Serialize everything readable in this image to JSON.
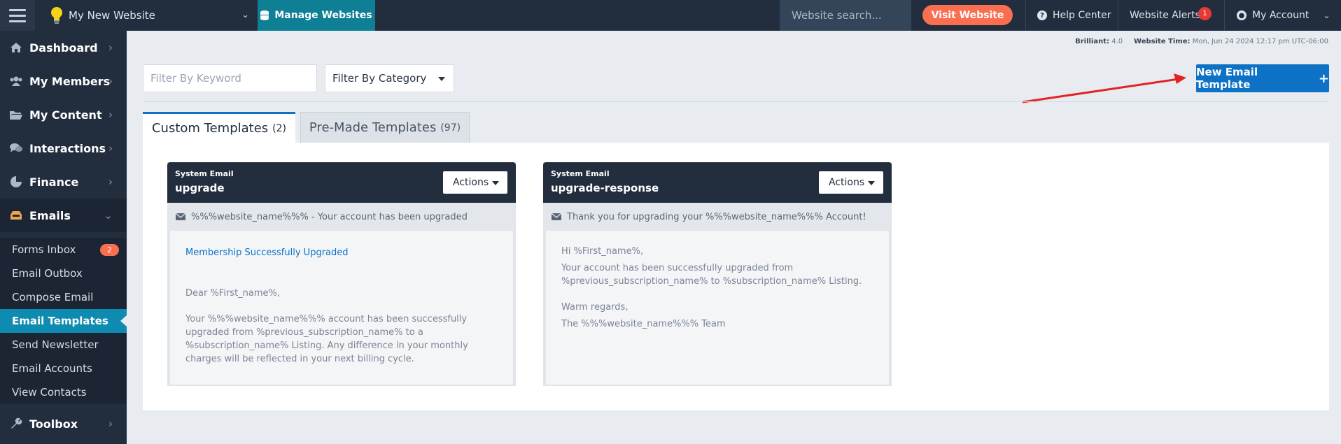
{
  "topbar": {
    "site_name": "My New Website",
    "manage_label": "Manage Websites",
    "search_placeholder": "Website search...",
    "visit_label": "Visit Website",
    "help_label": "Help Center",
    "alerts_label": "Website Alerts",
    "alerts_count": "1",
    "account_label": "My Account"
  },
  "sidebar": {
    "items": [
      {
        "label": "Dashboard",
        "icon": "home-icon"
      },
      {
        "label": "My Members",
        "icon": "users-icon"
      },
      {
        "label": "My Content",
        "icon": "folder-icon"
      },
      {
        "label": "Interactions",
        "icon": "comments-icon"
      },
      {
        "label": "Finance",
        "icon": "pie-chart-icon"
      },
      {
        "label": "Emails",
        "icon": "inbox-icon"
      },
      {
        "label": "Toolbox",
        "icon": "wrench-icon"
      }
    ],
    "email_subitems": [
      {
        "label": "Forms Inbox",
        "badge": "2"
      },
      {
        "label": "Email Outbox"
      },
      {
        "label": "Compose Email"
      },
      {
        "label": "Email Templates",
        "active": true
      },
      {
        "label": "Send Newsletter"
      },
      {
        "label": "Email Accounts"
      },
      {
        "label": "View Contacts"
      }
    ]
  },
  "info": {
    "version_label": "Brilliant:",
    "version_value": "4.0",
    "time_label": "Website Time:",
    "time_value": "Mon, Jun 24 2024 12:17 pm UTC-06:00"
  },
  "filters": {
    "keyword_placeholder": "Filter By Keyword",
    "category_label": "Filter By Category"
  },
  "new_template_label": "New Email Template",
  "tabs": [
    {
      "label": "Custom Templates",
      "count": "(2)"
    },
    {
      "label": "Pre-Made Templates",
      "count": "(97)"
    }
  ],
  "cards": [
    {
      "kind": "System Email",
      "title": "upgrade",
      "actions_label": "Actions",
      "subject": "%%%website_name%%% - Your account has been upgraded",
      "link_line": "Membership Successfully Upgraded",
      "greeting": "Dear %First_name%,",
      "paragraph": "Your %%%website_name%%% account has been successfully upgraded from %previous_subscription_name% to a %subscription_name% Listing. Any difference in your monthly charges will be reflected in your next billing cycle."
    },
    {
      "kind": "System Email",
      "title": "upgrade-response",
      "actions_label": "Actions",
      "subject": "Thank you for upgrading your %%%website_name%%% Account!",
      "greeting": "Hi %First_name%,",
      "paragraph": "Your account has been successfully upgraded from %previous_subscription_name% to %subscription_name% Listing.",
      "closing": "Warm regards,",
      "signature": "The %%%website_name%%% Team"
    }
  ],
  "colors": {
    "nav_bg": "#222e3e",
    "accent_teal": "#0f7f96",
    "visit_orange": "#fb6f51",
    "primary_blue": "#0d71c6",
    "annotation_arrow": "#e32222"
  }
}
